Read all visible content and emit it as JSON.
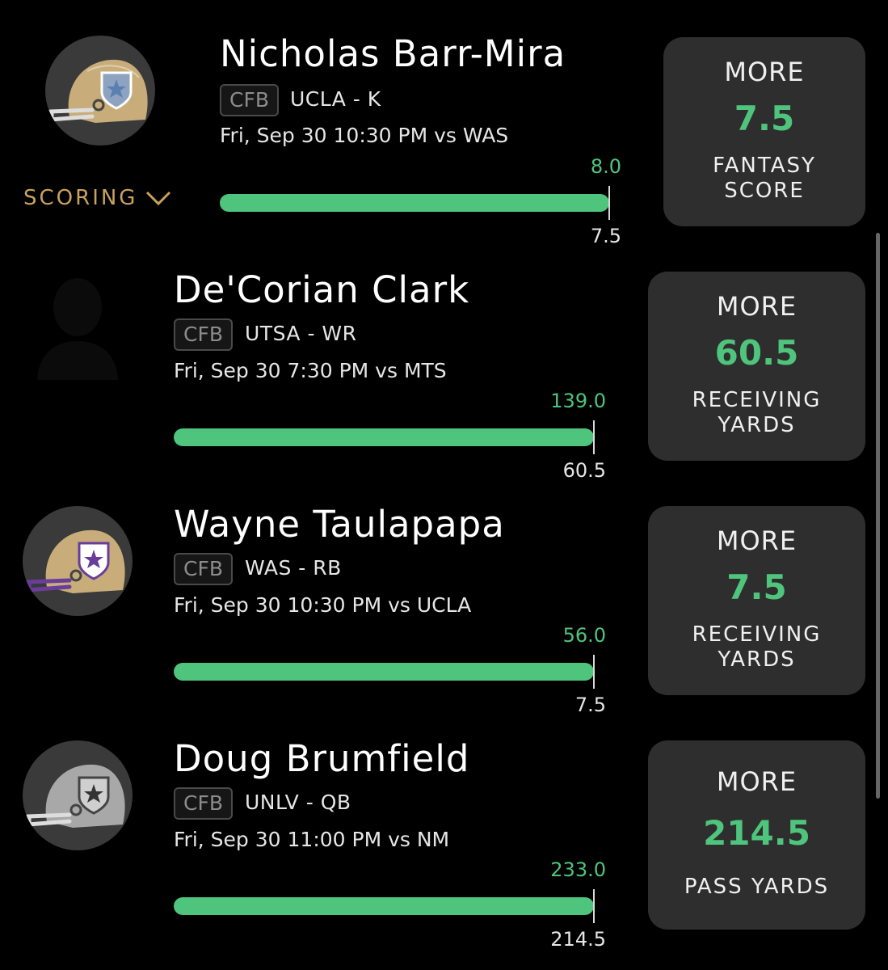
{
  "scoring_label": "SCORING",
  "colors": {
    "accent_green": "#4fc47c",
    "gold": "#c9a25c",
    "card_bg": "#2e2e2e"
  },
  "players": [
    {
      "name": "Nicholas Barr-Mira",
      "league": "CFB",
      "team_position": "UCLA - K",
      "game": "Fri, Sep 30 10:30 PM  vs WAS",
      "actual": "8.0",
      "line": "7.5",
      "pick": {
        "label": "MORE",
        "value": "7.5",
        "stat_line1": "FANTASY",
        "stat_line2": "SCORE"
      },
      "avatar_icon": "gold-helmet-icon"
    },
    {
      "name": "De'Corian Clark",
      "league": "CFB",
      "team_position": "UTSA - WR",
      "game": "Fri, Sep 30 7:30 PM  vs MTS",
      "actual": "139.0",
      "line": "60.5",
      "pick": {
        "label": "MORE",
        "value": "60.5",
        "stat_line1": "RECEIVING",
        "stat_line2": "YARDS"
      },
      "avatar_icon": "player-silhouette-icon"
    },
    {
      "name": "Wayne Taulapapa",
      "league": "CFB",
      "team_position": "WAS - RB",
      "game": "Fri, Sep 30 10:30 PM  vs UCLA",
      "actual": "56.0",
      "line": "7.5",
      "pick": {
        "label": "MORE",
        "value": "7.5",
        "stat_line1": "RECEIVING",
        "stat_line2": "YARDS"
      },
      "avatar_icon": "purple-helmet-icon"
    },
    {
      "name": "Doug Brumfield",
      "league": "CFB",
      "team_position": "UNLV - QB",
      "game": "Fri, Sep 30 11:00 PM  vs NM",
      "actual": "233.0",
      "line": "214.5",
      "pick": {
        "label": "MORE",
        "value": "214.5",
        "stat_line1": "PASS YARDS",
        "stat_line2": ""
      },
      "avatar_icon": "silver-helmet-icon"
    }
  ]
}
